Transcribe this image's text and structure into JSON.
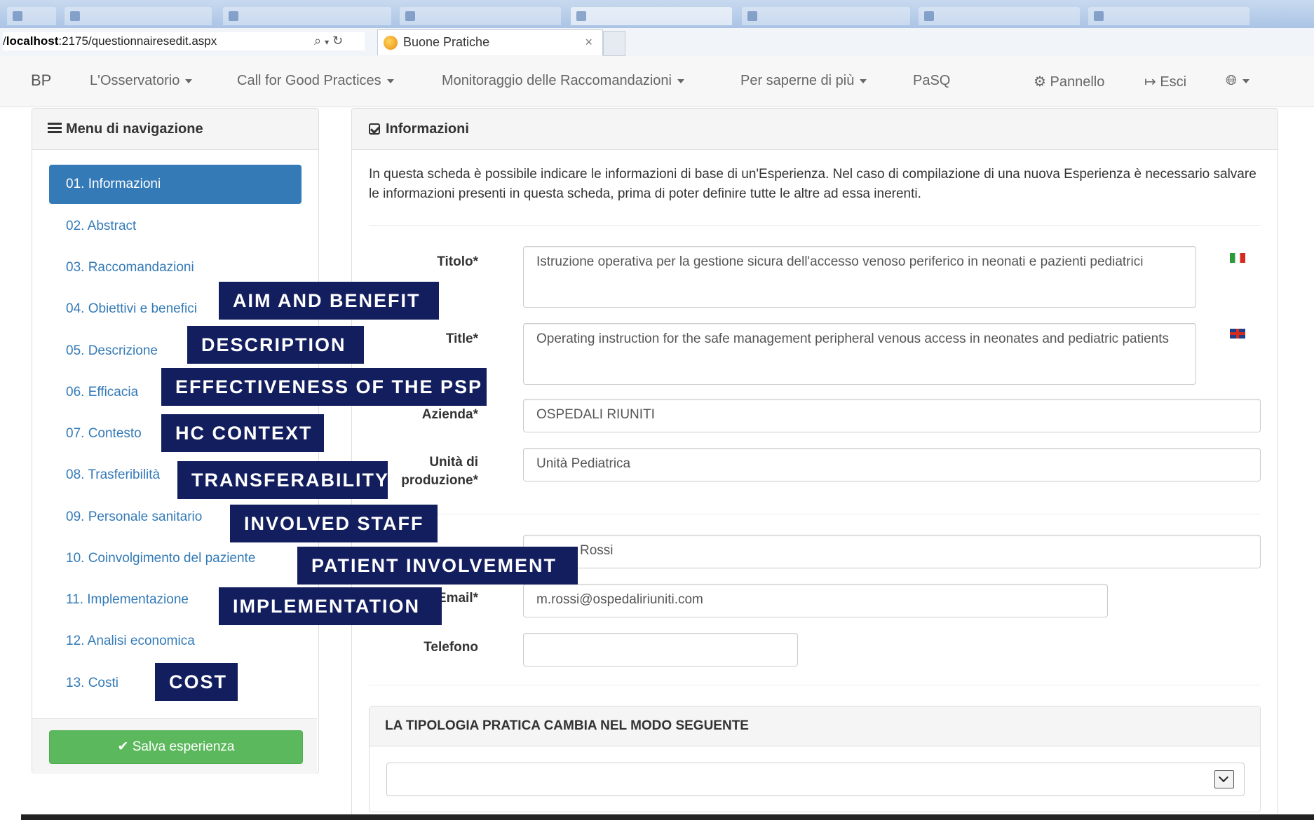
{
  "browser": {
    "url_host": "localhost",
    "url_rest": ":2175/questionnairesedit.aspx",
    "url_prefix": "/",
    "search_icon": "search-icon",
    "refresh_icon": "refresh-icon",
    "tab_label": "Buone Pratiche",
    "tab_close": "×"
  },
  "navbar": {
    "brand": "BP",
    "items": [
      {
        "label": "L'Osservatorio"
      },
      {
        "label": "Call for Good Practices"
      },
      {
        "label": "Monitoraggio delle Raccomandazioni"
      },
      {
        "label": "Per saperne di più"
      },
      {
        "label": "PaSQ"
      }
    ],
    "pannello": "Pannello",
    "esci": "Esci",
    "globe_icon": "globe-icon"
  },
  "left_menu": {
    "title": "Menu di navigazione",
    "items": [
      {
        "label": "01. Informazioni"
      },
      {
        "label": "02. Abstract"
      },
      {
        "label": "03. Raccomandazioni"
      },
      {
        "label": "04. Obiettivi e benefici"
      },
      {
        "label": "05. Descrizione"
      },
      {
        "label": "06. Efficacia"
      },
      {
        "label": "07. Contesto"
      },
      {
        "label": "08. Trasferibilità"
      },
      {
        "label": "09. Personale sanitario"
      },
      {
        "label": "10. Coinvolgimento del paziente"
      },
      {
        "label": "11. Implementazione"
      },
      {
        "label": "12. Analisi economica"
      },
      {
        "label": "13. Costi"
      }
    ],
    "save_label": "Salva esperienza"
  },
  "main": {
    "title": "Informazioni",
    "intro": "In questa scheda è possibile indicare le informazioni di base di un'Esperienza. Nel caso di compilazione di una nuova Esperienza è necessario salvare le informazioni presenti in questa scheda, prima di poter definire tutte le altre ad essa inerenti.",
    "fields": {
      "titolo_label": "Titolo*",
      "titolo_value": "Istruzione operativa per la gestione sicura dell'accesso venoso periferico in neonati e pazienti pediatrici",
      "title_label": "Title*",
      "title_value": "Operating instruction for the safe management peripheral venous access in neonates and pediatric patients",
      "azienda_label": "Azienda*",
      "azienda_value": "OSPEDALI RIUNITI",
      "unita_label": "Unità di produzione*",
      "unita_value": "Unità Pediatrica",
      "nome_value": "Rossi",
      "email_label": "Email*",
      "email_value": "m.rossi@ospedaliriuniti.com",
      "telefono_label": "Telefono",
      "telefono_value": ""
    },
    "subsection_title": "LA TIPOLOGIA PRATICA CAMBIA NEL MODO SEGUENTE",
    "select_value": ""
  },
  "overlay_labels": {
    "aim": "AIM AND BENEFIT",
    "description": "DESCRIPTION",
    "effectiveness": "EFFECTIVENESS OF THE PSP",
    "context": "HC CONTEXT",
    "transferability": "TRANSFERABILITY",
    "staff": "INVOLVED STAFF",
    "patient": "PATIENT INVOLVEMENT",
    "implementation": "IMPLEMENTATION",
    "cost": "COST"
  },
  "colors": {
    "primary": "#337ab7",
    "success": "#5cb85c",
    "overlay": "#131e5e"
  }
}
